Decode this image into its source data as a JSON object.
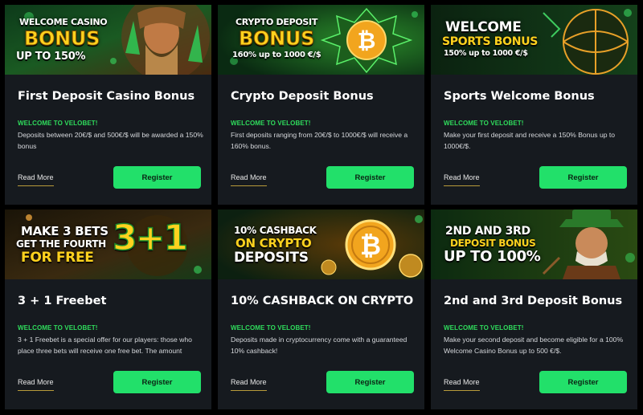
{
  "cards": [
    {
      "banner": {
        "line1": "Welcome Casino",
        "line2": "Bonus",
        "line3": "Up to 150%"
      },
      "title": "First Deposit Casino Bonus",
      "tag": "WELCOME TO VELOBET!",
      "description": "Deposits between 20€/$ and 500€/$ will be awarded a 150% bonus",
      "read_more": "Read More",
      "register": "Register"
    },
    {
      "banner": {
        "line1": "Crypto Deposit",
        "line2": "Bonus",
        "line3": "160% up to 1000 €/$"
      },
      "title": "Crypto Deposit Bonus",
      "tag": "WELCOME TO VELOBET!",
      "description": "First deposits ranging from 20€/$ to 1000€/$ will receive a 160% bonus.",
      "read_more": "Read More",
      "register": "Register"
    },
    {
      "banner": {
        "line1": "Welcome",
        "line2": "Sports Bonus",
        "line3": "150% up to 1000 €/$"
      },
      "title": "Sports Welcome Bonus",
      "tag": "WELCOME TO VELOBET!",
      "description": "Make your first deposit and receive a 150% Bonus up to 1000€/$.",
      "read_more": "Read More",
      "register": "Register"
    },
    {
      "banner": {
        "line1": "Make 3 bets",
        "line2": "Get the fourth",
        "line3": "For free",
        "badge": "3+1"
      },
      "title": "3 + 1 Freebet",
      "tag": "WELCOME TO VELOBET!",
      "description": "3 + 1 Freebet is a special offer for our players: those who place three bets will receive one free bet. The amount",
      "read_more": "Read More",
      "register": "Register"
    },
    {
      "banner": {
        "line1": "10% Cashback",
        "line2": "On crypto",
        "line3": "Deposits"
      },
      "title": "10% CASHBACK ON CRYPTO ...",
      "tag": "WELCOME TO VELOBET!",
      "description": "Deposits made in cryptocurrency come with a guaranteed 10% cashback!",
      "read_more": "Read More",
      "register": "Register"
    },
    {
      "banner": {
        "line1": "2nd and 3rd",
        "line2": "Deposit Bonus",
        "line3": "Up to 100%"
      },
      "title": "2nd and 3rd Deposit Bonus U...",
      "tag": "WELCOME TO VELOBET!",
      "description": "Make your second deposit and become eligible for a 100% Welcome Casino Bonus up to 500 €/$.",
      "read_more": "Read More",
      "register": "Register"
    }
  ],
  "colors": {
    "card_bg": "#161a1f",
    "accent_green": "#22e06a",
    "tag_green": "#2fdc5c",
    "banner_yellow": "#ffd21e"
  }
}
